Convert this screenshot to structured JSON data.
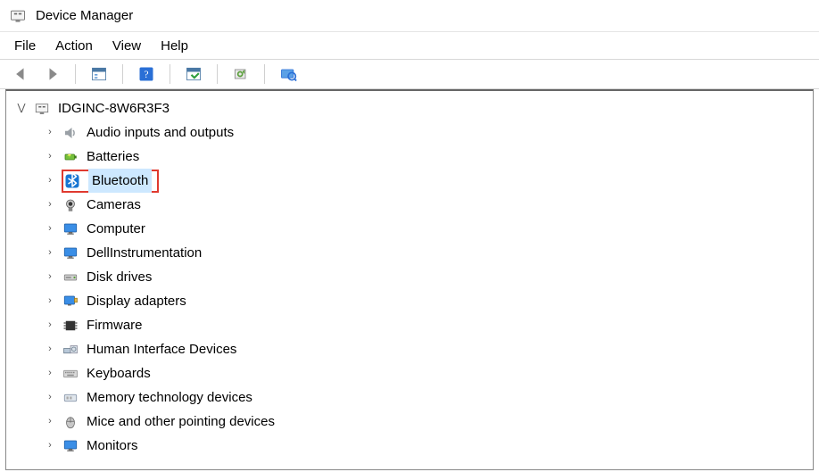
{
  "window": {
    "title": "Device Manager"
  },
  "menu": {
    "file": "File",
    "action": "Action",
    "view": "View",
    "help": "Help"
  },
  "toolbar_icons": {
    "back": "back-icon",
    "forward": "forward-icon",
    "properties": "properties-icon",
    "help": "help-icon",
    "scan": "scan-icon",
    "update": "update-icon",
    "show": "show-icon"
  },
  "tree": {
    "root": {
      "label": "IDGINC-8W6R3F3",
      "expanded": true
    },
    "items": [
      {
        "label": "Audio inputs and outputs",
        "icon": "speaker"
      },
      {
        "label": "Batteries",
        "icon": "battery"
      },
      {
        "label": "Bluetooth",
        "icon": "bluetooth",
        "highlighted": true
      },
      {
        "label": "Cameras",
        "icon": "camera"
      },
      {
        "label": "Computer",
        "icon": "monitor"
      },
      {
        "label": "DellInstrumentation",
        "icon": "monitor"
      },
      {
        "label": "Disk drives",
        "icon": "disk"
      },
      {
        "label": "Display adapters",
        "icon": "display"
      },
      {
        "label": "Firmware",
        "icon": "chip"
      },
      {
        "label": "Human Interface Devices",
        "icon": "hid"
      },
      {
        "label": "Keyboards",
        "icon": "keyboard"
      },
      {
        "label": "Memory technology devices",
        "icon": "memory"
      },
      {
        "label": "Mice and other pointing devices",
        "icon": "mouse"
      },
      {
        "label": "Monitors",
        "icon": "monitor"
      }
    ]
  }
}
